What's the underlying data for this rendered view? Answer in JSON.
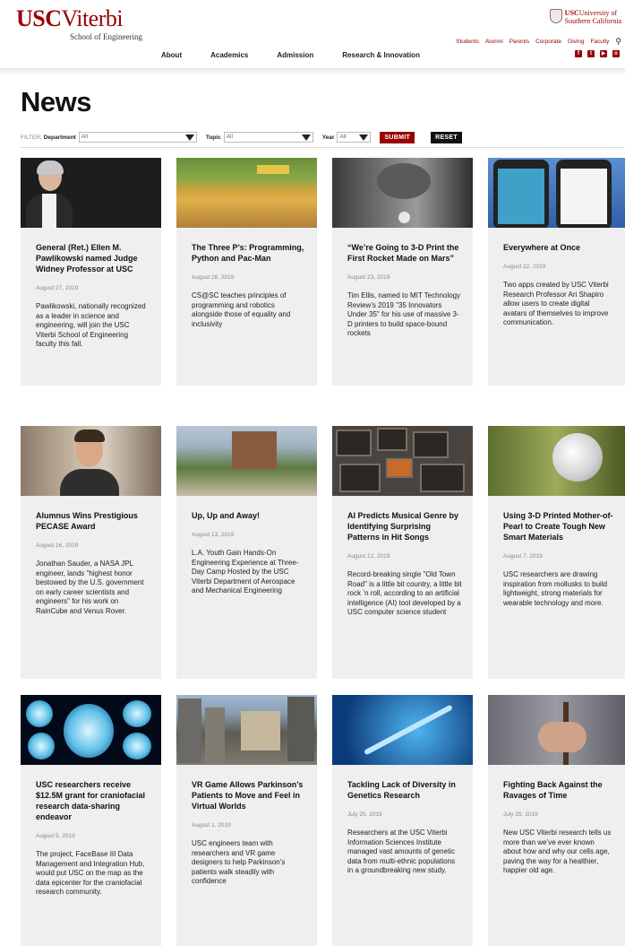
{
  "header": {
    "logo_usc": "USC",
    "logo_viterbi": "Viterbi",
    "logo_sub": "School of Engineering",
    "university_usc": "USC",
    "university_line1": "University of",
    "university_line2": "Southern California",
    "audience_links": [
      "Students",
      "Alumni",
      "Parents",
      "Corporate",
      "Giving",
      "Faculty"
    ],
    "search_icon": "search-icon",
    "social_icons": [
      "facebook-icon",
      "twitter-icon",
      "youtube-icon",
      "instagram-icon"
    ],
    "nav": [
      "About",
      "Academics",
      "Admission",
      "Research & Innovation"
    ],
    "brand_color": "#990000"
  },
  "page": {
    "title": "News"
  },
  "filter": {
    "prefix": "FILTER:",
    "department_label": "Department",
    "department_value": "All",
    "topic_label": "Topic",
    "topic_value": "All",
    "year_label": "Year",
    "year_value": "All",
    "submit_label": "SUBMIT",
    "reset_label": "RESET"
  },
  "cards": [
    {
      "title": "General (Ret.) Ellen M. Pawlikowski named Judge Widney Professor at USC",
      "date": "August 27, 2019",
      "desc": "Pawlikowski, nationally recognized as a leader in science and engineering, will join the USC Viterbi School of Engineering faculty this fall."
    },
    {
      "title": "The Three P’s: Programming, Python and Pac-Man",
      "date": "August 26, 2019",
      "desc": "CS@SC teaches principles of programming and robotics alongside those of equality and inclusivity"
    },
    {
      "title": "“We’re Going to 3-D Print the First Rocket Made on Mars”",
      "date": "August 23, 2019",
      "desc": "Tim Ellis, named to MIT Technology Review’s 2019 \"35 Innovators Under 35\" for his use of massive 3-D printers to build space-bound rockets"
    },
    {
      "title": "Everywhere at Once",
      "date": "August 22, 2019",
      "desc": "Two apps created by USC Viterbi Research Professor Ari Shapiro allow users to create digital avatars of themselves to improve communication."
    },
    {
      "title": "Alumnus Wins Prestigious PECASE Award",
      "date": "August 16, 2019",
      "desc": "Jonathan Sauder, a NASA JPL engineer, lands \"highest honor bestowed by the U.S. government on early career scientists and engineers\" for his work on RainCube and Venus Rover."
    },
    {
      "title": "Up, Up and Away!",
      "date": "August 13, 2019",
      "desc": "L.A. Youth Gain Hands-On Engineering Experience at Three-Day Camp Hosted by the USC Viterbi Department of Aerospace and Mechanical Engineering"
    },
    {
      "title": "AI Predicts Musical Genre by Identifying Surprising Patterns in Hit Songs",
      "date": "August 12, 2019",
      "desc": "Record-breaking single \"Old Town Road\" is a little bit country, a little bit rock ’n roll, according to an artificial intelligence (AI) tool developed by a USC computer science student"
    },
    {
      "title": "Using 3-D Printed Mother-of-Pearl to Create Tough New Smart Materials",
      "date": "August 7, 2019",
      "desc": "USC researchers are drawing inspiration from mollusks to build lightweight, strong materials for wearable technology and more."
    },
    {
      "title": "USC researchers receive $12.5M grant for craniofacial research data-sharing endeavor",
      "date": "August 5, 2019",
      "desc": "The project, FaceBase III Data Management and Integration Hub, would put USC on the map as the data epicenter for the craniofacial research community."
    },
    {
      "title": "VR Game Allows Parkinson’s Patients to Move and Feel in Virtual Worlds",
      "date": "August 1, 2019",
      "desc": "USC engineers team with researchers and VR game designers to help Parkinson’s patients walk steadily with confidence"
    },
    {
      "title": "Tackling Lack of Diversity in Genetics Research",
      "date": "July 25, 2019",
      "desc": "Researchers at the USC Viterbi Information Sciences Institute managed vast amounts of genetic data from multi-ethnic populations in a groundbreaking new study."
    },
    {
      "title": "Fighting Back Against the Ravages of Time",
      "date": "July 25, 2019",
      "desc": "New USC Viterbi research tells us more than we’ve ever known about how and why our cells age, paving the way for a healthier, happier old age."
    }
  ]
}
